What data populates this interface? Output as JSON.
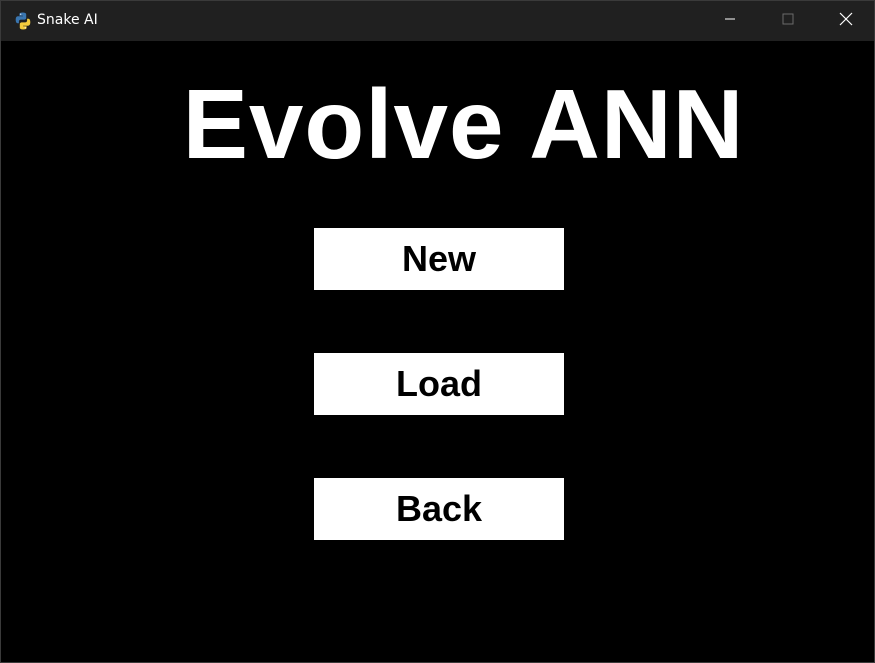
{
  "window": {
    "title": "Snake AI",
    "app_icon": "python-icon",
    "controls": {
      "minimize_icon": "minimize-icon",
      "maximize_icon": "maximize-icon",
      "close_icon": "close-icon"
    }
  },
  "screen": {
    "heading": "Evolve ANN",
    "buttons": {
      "new_label": "New",
      "load_label": "Load",
      "back_label": "Back"
    }
  },
  "colors": {
    "background": "#000000",
    "titlebar": "#202020",
    "button_fill": "#ffffff",
    "button_text": "#000000",
    "heading_text": "#ffffff"
  }
}
